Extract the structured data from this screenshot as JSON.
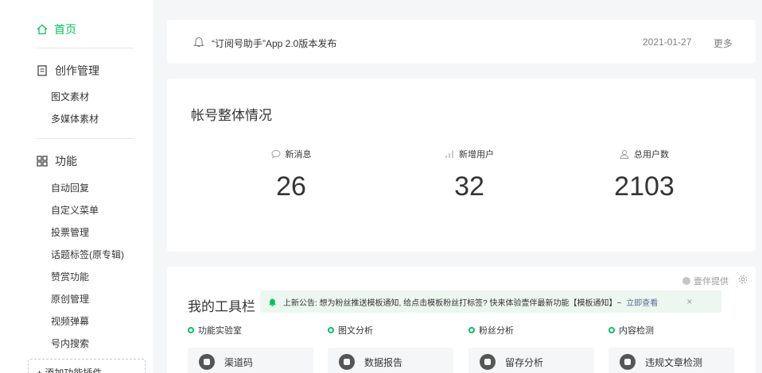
{
  "sidebar": {
    "home_label": "首页",
    "groups": [
      {
        "title": "创作管理",
        "icon": "document-icon",
        "items": [
          "图文素材",
          "多媒体素材"
        ]
      },
      {
        "title": "功能",
        "icon": "grid-icon",
        "items": [
          "自动回复",
          "自定义菜单",
          "投票管理",
          "话题标签(原专辑)",
          "赞赏功能",
          "原创管理",
          "视频弹幕",
          "号内搜索"
        ]
      }
    ],
    "add_plugin_label": "+ 添加功能插件"
  },
  "notice": {
    "text": "“订阅号助手”App 2.0版本发布",
    "date": "2021-01-27",
    "more": "更多"
  },
  "overview": {
    "title": "帐号整体情况",
    "stats": [
      {
        "label": "新消息",
        "value": "26",
        "icon": "message-icon"
      },
      {
        "label": "新增用户",
        "value": "32",
        "icon": "bar-chart-icon"
      },
      {
        "label": "总用户数",
        "value": "2103",
        "icon": "user-icon"
      }
    ]
  },
  "tools": {
    "title": "我的工具栏",
    "provider": "壹伴提供",
    "announcement": {
      "text": "上新公告: 想为粉丝推送模板通知, 给点击模板粉丝打标签? 快来体验壹伴最新功能【模板通知】~",
      "link": "立即查看",
      "close": "×"
    },
    "columns": [
      {
        "title": "功能实验室",
        "button": "渠道码"
      },
      {
        "title": "图文分析",
        "button": "数据报告"
      },
      {
        "title": "粉丝分析",
        "button": "留存分析"
      },
      {
        "title": "内容检测",
        "button": "违规文章检测"
      }
    ]
  },
  "colors": {
    "accent": "#07c160",
    "link": "#576b95",
    "background": "#f5f6f7"
  }
}
